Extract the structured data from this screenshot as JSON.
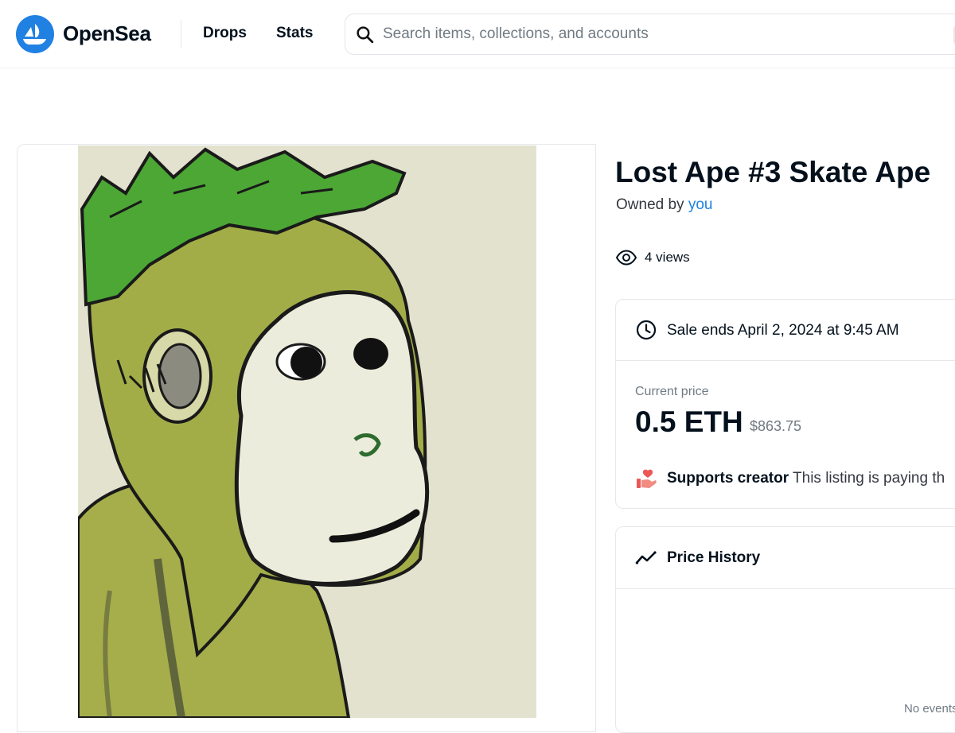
{
  "header": {
    "brand": "OpenSea",
    "nav": [
      "Drops",
      "Stats"
    ],
    "search_placeholder": "Search items, collections, and accounts"
  },
  "item": {
    "title": "Lost Ape #3 Skate Ape",
    "owned_by_prefix": "Owned by",
    "owner": "you",
    "views": "4 views"
  },
  "sale": {
    "ends": "Sale ends April 2, 2024 at 9:45 AM",
    "current_price_label": "Current price",
    "price_eth": "0.5 ETH",
    "price_usd": "$863.75",
    "supports_creator": "Supports creator",
    "supports_text": "This listing is paying th"
  },
  "price_history": {
    "title": "Price History",
    "empty_text": "No events"
  },
  "colors": {
    "brand_blue": "#2081e2",
    "text_primary": "#04111d",
    "text_secondary": "#707a83",
    "border": "#e5e8eb",
    "art_background": "#e3e2cf",
    "ape_fur": "#a3ad48",
    "mohawk": "#4ca735",
    "face": "#ececdc"
  }
}
